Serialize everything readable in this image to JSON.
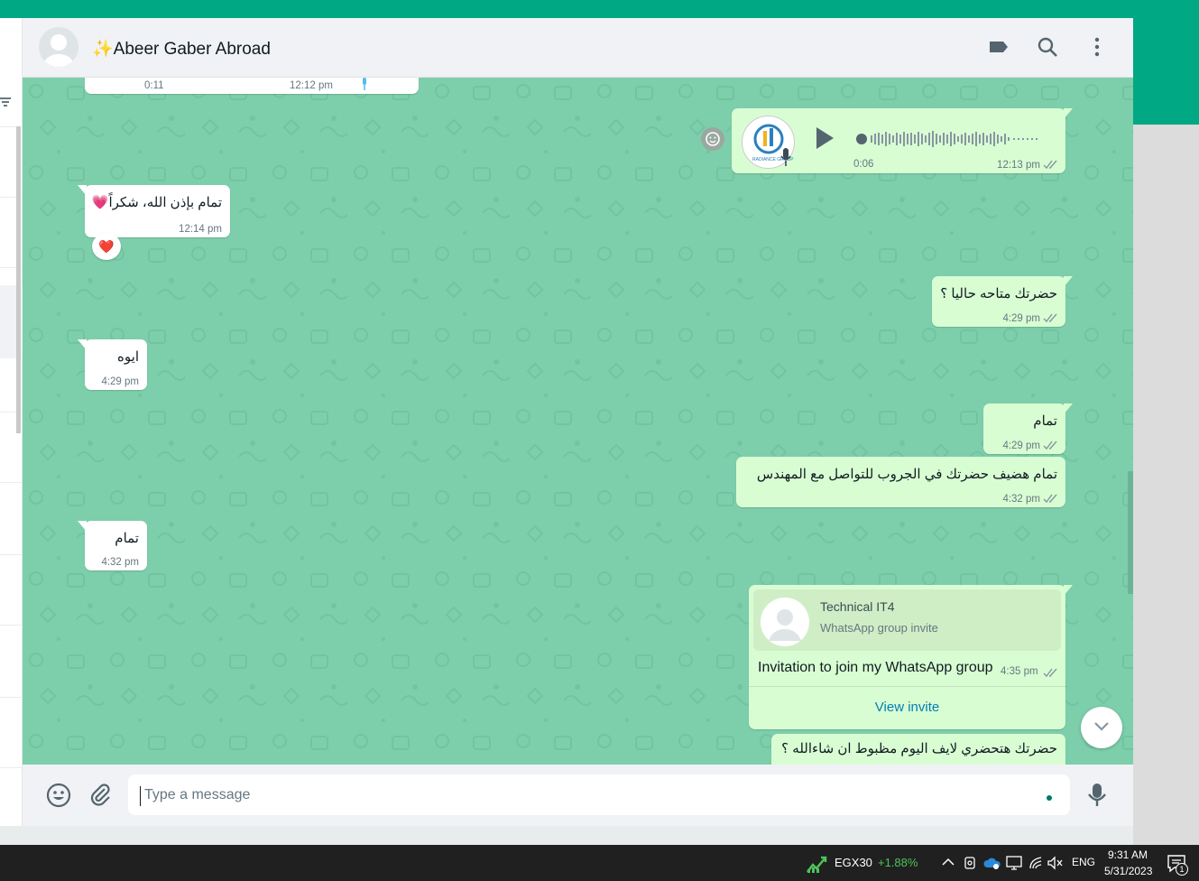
{
  "header": {
    "contact_name": "✨Abeer Gaber Abroad"
  },
  "messages": {
    "prev_duration": "0:11",
    "prev_time": "12:12 pm",
    "voice": {
      "duration": "0:06",
      "time": "12:13 pm",
      "logo_text": "RADIANCE GROUP"
    },
    "m1": {
      "text": "تمام بإذن الله، شكراً💗",
      "time": "12:14 pm",
      "reaction": "❤️"
    },
    "m2": {
      "text": "حضرتك متاحه حاليا ؟",
      "time": "4:29 pm"
    },
    "m3": {
      "text": "ايوه",
      "time": "4:29 pm"
    },
    "m4": {
      "text": "تمام",
      "time": "4:29 pm"
    },
    "m5": {
      "text": "تمام هضيف حضرتك في الجروب للتواصل مع المهندس",
      "time": "4:32 pm"
    },
    "m6": {
      "text": "تمام",
      "time": "4:32 pm"
    },
    "invite": {
      "group_name": "Technical IT4",
      "subtitle": "WhatsApp group invite",
      "text": "Invitation to join my WhatsApp group",
      "time": "4:35 pm",
      "action": "View invite"
    },
    "m7": {
      "text": "حضرتك هتحضري لايف اليوم مظبوط ان شاءالله ؟"
    }
  },
  "composer": {
    "placeholder": "Type a message"
  },
  "taskbar": {
    "ticker": "EGX30",
    "change": "+1.88%",
    "lang": "ENG",
    "time": "9:31 AM",
    "date": "5/31/2023",
    "notif_count": "1"
  },
  "colors": {
    "brand": "#00a884",
    "chat_bg": "#7dceaa",
    "outgoing": "#d9fdd3",
    "incoming": "#ffffff",
    "ticker_up": "#4cc35a"
  }
}
